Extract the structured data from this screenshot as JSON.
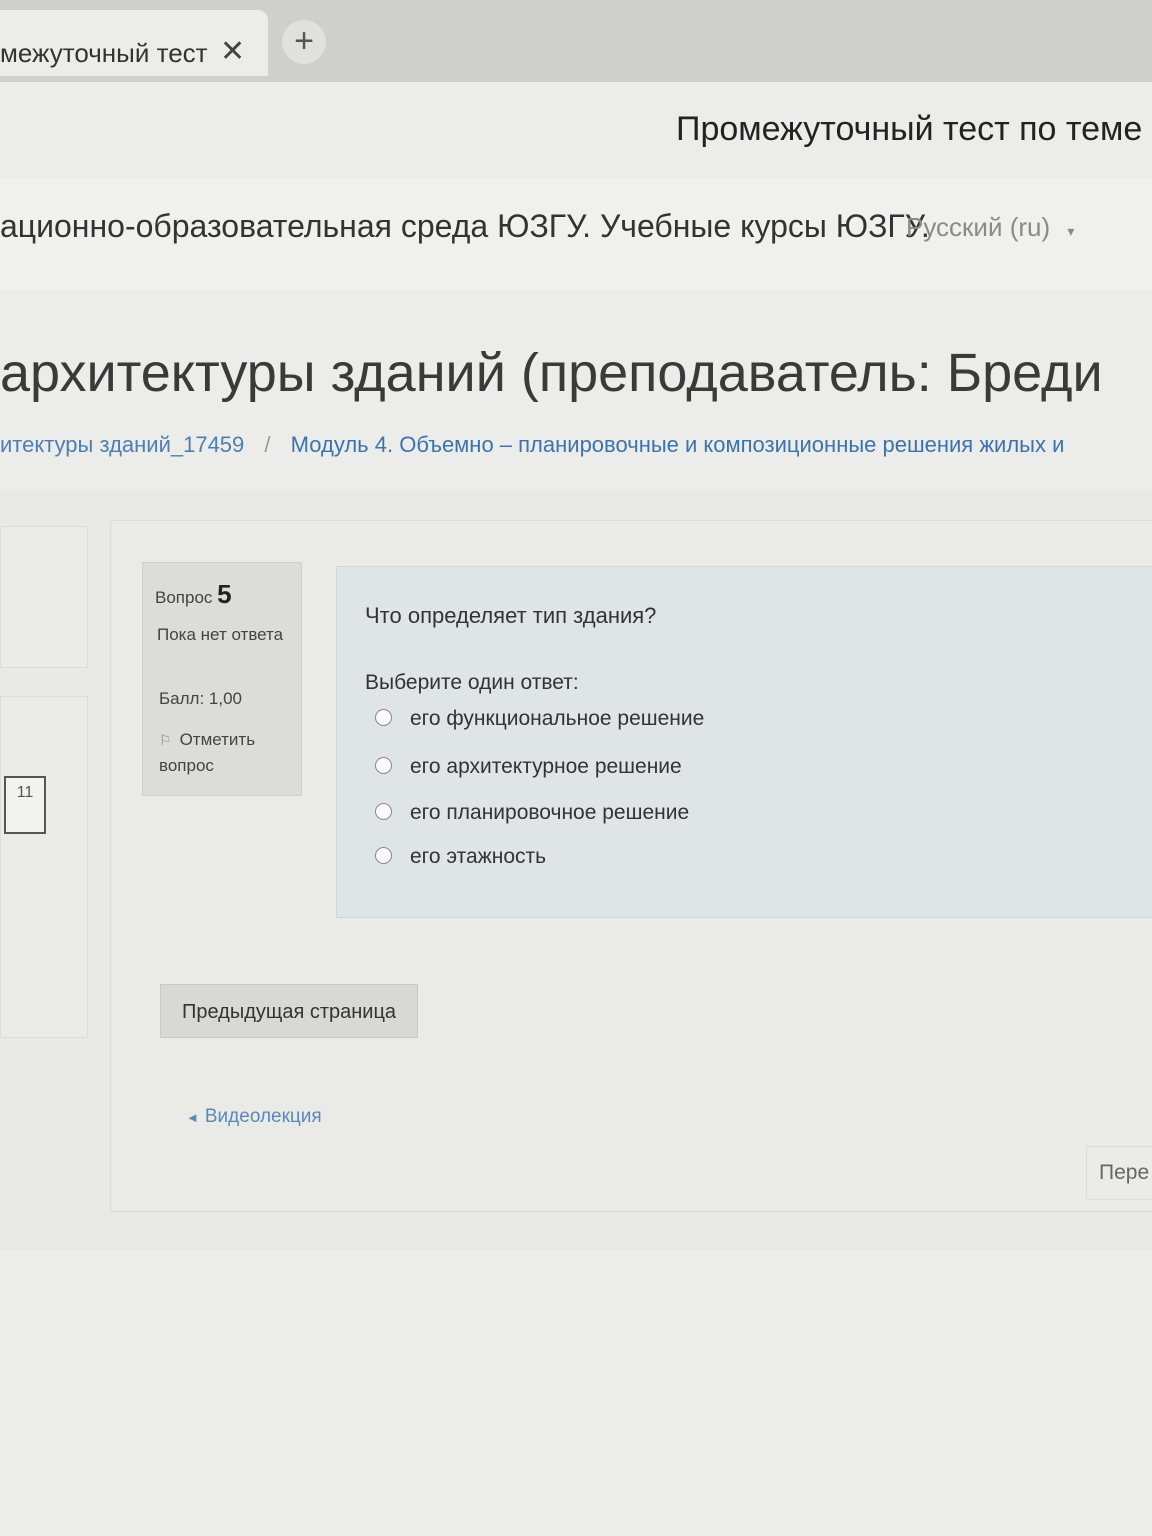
{
  "browser": {
    "tab_title": "межуточный тест",
    "tab_close": "✕",
    "new_tab": "+",
    "window_title": "Промежуточный тест по теме М"
  },
  "navbar": {
    "site_name": "ационно-образовательная среда ЮЗГУ. Учебные курсы ЮЗГУ.",
    "language": "Русский (ru)"
  },
  "header": {
    "course_title": "архитектуры зданий (преподаватель: Бреди",
    "breadcrumb": [
      "итектуры зданий_17459",
      "Модуль 4. Объемно – планировочные и композиционные решения жилых и"
    ],
    "breadcrumb_separator": "/"
  },
  "quiz_nav": {
    "button_label": "11"
  },
  "question_info": {
    "label": "Вопрос",
    "number": "5",
    "state": "Пока нет ответа",
    "grade": "Балл: 1,00",
    "flag": "Отметить вопрос"
  },
  "question": {
    "text": "Что определяет тип здания?",
    "prompt": "Выберите один ответ:",
    "answers": [
      "его функциональное решение",
      "его архитектурное решение",
      "его планировочное решение",
      "его этажность"
    ]
  },
  "controls": {
    "prev_page": "Предыдущая страница",
    "activity_link": "Видеолекция",
    "next_activity": "Пере"
  },
  "colors": {
    "link": "#3b74ad",
    "question_bg": "#dfe4e6",
    "info_bg": "#dcdcd9"
  }
}
